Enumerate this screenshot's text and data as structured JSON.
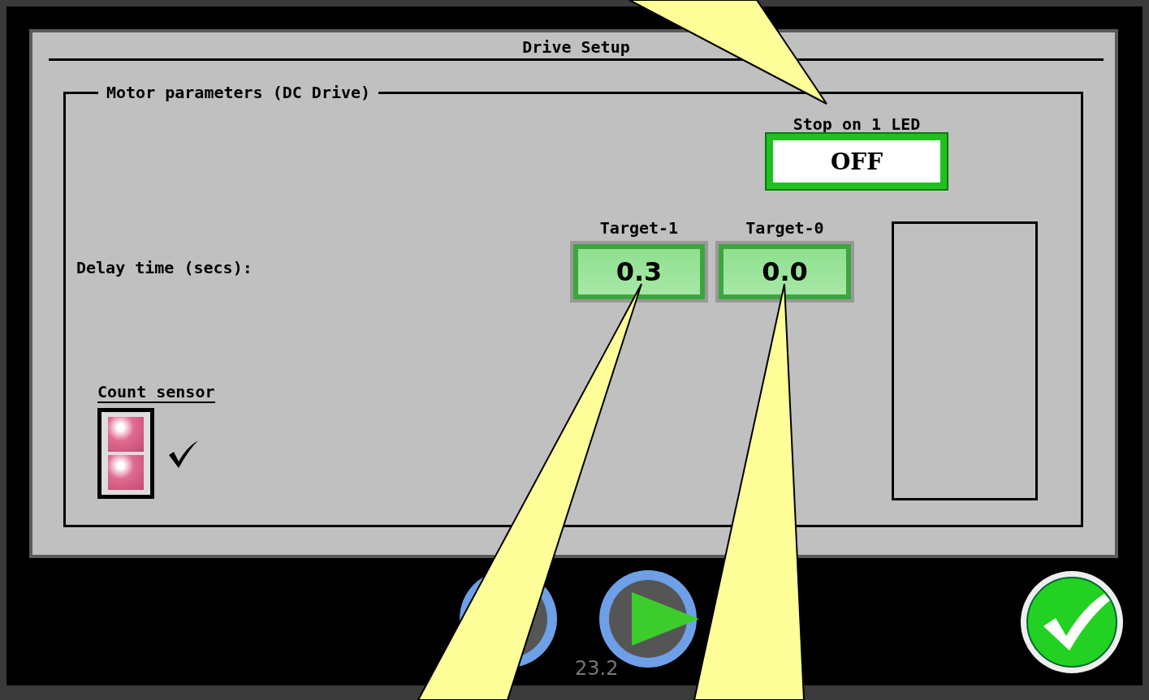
{
  "title": "Drive Setup",
  "group": {
    "legend": "Motor parameters (DC Drive)",
    "stop_led": {
      "label": "Stop on 1 LED",
      "value": "OFF"
    },
    "delay_label": "Delay time (secs):",
    "targets": [
      {
        "label": "Target-1",
        "value": "0.3"
      },
      {
        "label": "Target-0",
        "value": "0.0"
      }
    ],
    "count_sensor": {
      "label": "Count sensor",
      "checked": true
    }
  },
  "footer": {
    "version": "23.2"
  }
}
